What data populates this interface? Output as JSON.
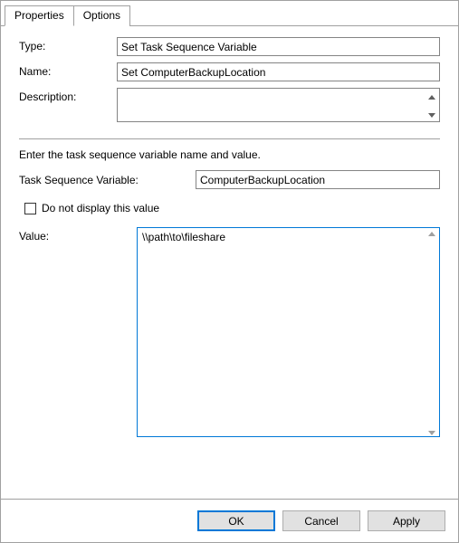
{
  "tabs": {
    "properties": "Properties",
    "options": "Options"
  },
  "labels": {
    "type": "Type:",
    "name": "Name:",
    "description": "Description:",
    "instruction": "Enter the task sequence variable name and value.",
    "task_seq_var": "Task Sequence Variable:",
    "do_not_display": "Do not display this value",
    "value": "Value:"
  },
  "fields": {
    "type": "Set Task Sequence Variable",
    "name": "Set ComputerBackupLocation",
    "description": "",
    "task_seq_var": "ComputerBackupLocation",
    "value": "\\\\path\\to\\fileshare"
  },
  "buttons": {
    "ok": "OK",
    "cancel": "Cancel",
    "apply": "Apply"
  }
}
